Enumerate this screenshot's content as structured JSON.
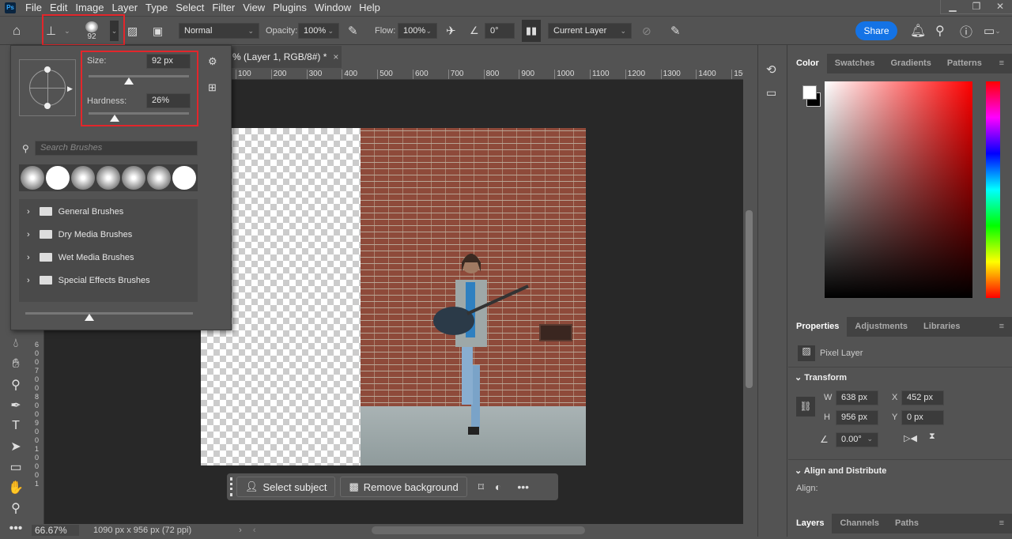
{
  "app": {
    "logo": "Ps",
    "menu": [
      "File",
      "Edit",
      "Image",
      "Layer",
      "Type",
      "Select",
      "Filter",
      "View",
      "Plugins",
      "Window",
      "Help"
    ],
    "window_controls": [
      "minimize",
      "restore",
      "close"
    ]
  },
  "options": {
    "brush_size": "92",
    "blend_mode": "Normal",
    "opacity_label": "Opacity:",
    "opacity": "100%",
    "flow_label": "Flow:",
    "flow": "100%",
    "angle": "0°",
    "sample": "Current Layer",
    "share": "Share"
  },
  "document": {
    "tab_title": "% (Layer 1, RGB/8#) *",
    "ruler": [
      "100",
      "200",
      "300",
      "400",
      "500",
      "600",
      "700",
      "800",
      "900",
      "1000",
      "1100",
      "1200",
      "1300",
      "1400",
      "15C"
    ],
    "vruler": [
      "6",
      "0",
      "0",
      "7",
      "0",
      "0",
      "8",
      "0",
      "0",
      "9",
      "0",
      "0",
      "1",
      "0",
      "0",
      "0",
      "1"
    ]
  },
  "brush_panel": {
    "size_label": "Size:",
    "size": "92 px",
    "size_pct": 40,
    "hardness_label": "Hardness:",
    "hardness": "26%",
    "hardness_pct": 26,
    "search_placeholder": "Search Brushes",
    "folders": [
      "General Brushes",
      "Dry Media Brushes",
      "Wet Media Brushes",
      "Special Effects Brushes"
    ]
  },
  "taskbar": {
    "select_subject": "Select subject",
    "remove_background": "Remove background"
  },
  "status": {
    "zoom": "66.67%",
    "doc_info": "1090 px x 956 px (72 ppi)"
  },
  "color_panel": {
    "tabs": [
      "Color",
      "Swatches",
      "Gradients",
      "Patterns"
    ],
    "hue": "#ff0000"
  },
  "properties": {
    "tabs": [
      "Properties",
      "Adjustments",
      "Libraries"
    ],
    "layer_type": "Pixel Layer",
    "transform_label": "Transform",
    "w_label": "W",
    "w": "638 px",
    "h_label": "H",
    "h": "956 px",
    "x_label": "X",
    "x": "452 px",
    "y_label": "Y",
    "y": "0 px",
    "angle": "0.00°",
    "align_title": "Align and Distribute",
    "align_label": "Align:"
  },
  "layers_panel": {
    "tabs": [
      "Layers",
      "Channels",
      "Paths"
    ]
  }
}
